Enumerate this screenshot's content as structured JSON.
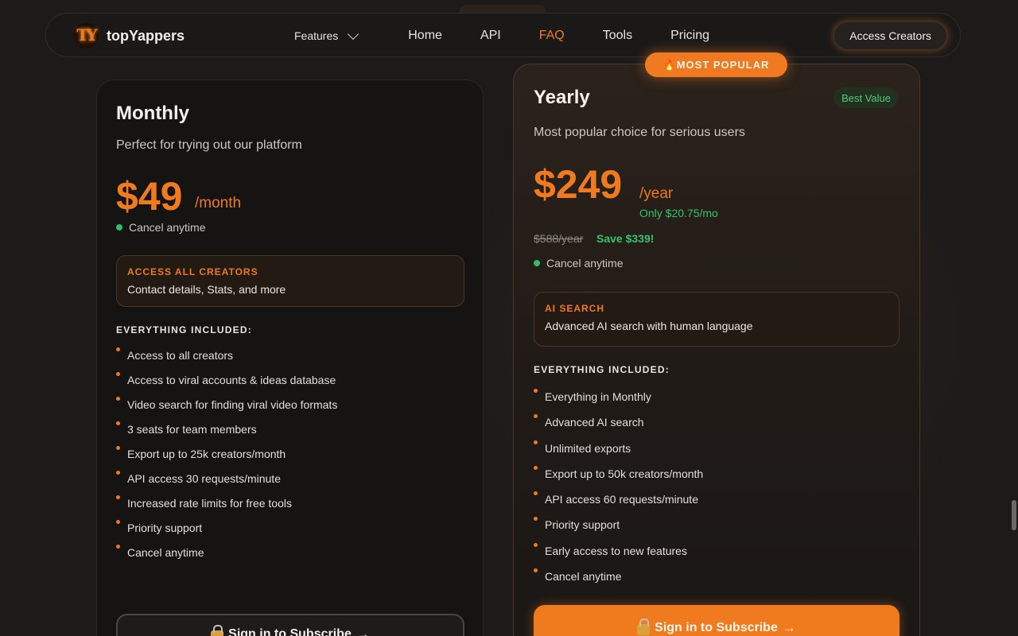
{
  "nav": {
    "brand": "topYappers",
    "logo_letters": "TY",
    "links": [
      {
        "label": "Features",
        "has_dropdown": true
      },
      {
        "label": "Home"
      },
      {
        "label": "API"
      },
      {
        "label": "FAQ",
        "active": true
      },
      {
        "label": "Tools"
      },
      {
        "label": "Pricing"
      }
    ],
    "cta": "Access Creators"
  },
  "monthly": {
    "title": "Monthly",
    "description": "Perfect for trying out our platform",
    "price": "$49",
    "period": "/month",
    "cancel_note": "Cancel anytime",
    "highlight_title": "ACCESS ALL CREATORS",
    "highlight_text": "Contact details, Stats, and more",
    "included_heading": "EVERYTHING INCLUDED:",
    "features": [
      "Access to all creators",
      "Access to viral accounts & ideas database",
      "Video search for finding viral video formats",
      "3 seats for team members",
      "Export up to 25k creators/month",
      "API access 30 requests/minute",
      "Increased rate limits for free tools",
      "Priority support",
      "Cancel anytime"
    ],
    "button": "Sign in to Subscribe"
  },
  "yearly": {
    "badge": "🔥MOST POPULAR",
    "best_value": "Best Value",
    "title": "Yearly",
    "description": "Most popular choice for serious users",
    "price": "$249",
    "period": "/year",
    "monthly_equiv": "Only $20.75/mo",
    "old_price": "$588/year",
    "save": "Save $339!",
    "cancel_note": "Cancel anytime",
    "highlight_title": "AI SEARCH",
    "highlight_text": "Advanced AI search with human language",
    "included_heading": "EVERYTHING INCLUDED:",
    "features": [
      "Everything in Monthly",
      "Advanced AI search",
      "Unlimited exports",
      "Export up to 50k creators/month",
      "API access 60 requests/minute",
      "Priority support",
      "Early access to new features",
      "Cancel anytime"
    ],
    "button": "Sign in to Subscribe"
  },
  "colors": {
    "accent": "#f07a1e",
    "success": "#34c36a",
    "background": "#1c1b1a"
  },
  "icons": [
    "logo-icon",
    "chevron-down-icon",
    "lock-icon",
    "arrow-right-icon",
    "bullet-dot-icon",
    "status-dot-icon"
  ]
}
